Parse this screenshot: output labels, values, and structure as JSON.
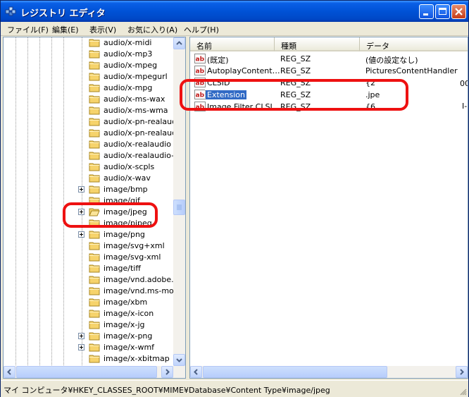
{
  "window": {
    "title": "レジストリ エディタ",
    "title_icon": "registry-editor-icon",
    "controls": [
      "minimize-icon",
      "maximize-icon",
      "close-icon"
    ]
  },
  "menu": [
    {
      "label": "ファイル(F)"
    },
    {
      "label": "編集(E)"
    },
    {
      "label": "表示(V)"
    },
    {
      "label": "お気に入り(A)"
    },
    {
      "label": "ヘルプ(H)"
    }
  ],
  "tree": {
    "items": [
      {
        "label": "audio/x-midi",
        "expander": false
      },
      {
        "label": "audio/x-mp3",
        "expander": false
      },
      {
        "label": "audio/x-mpeg",
        "expander": false
      },
      {
        "label": "audio/x-mpegurl",
        "expander": false
      },
      {
        "label": "audio/x-mpg",
        "expander": false
      },
      {
        "label": "audio/x-ms-wax",
        "expander": false
      },
      {
        "label": "audio/x-ms-wma",
        "expander": false
      },
      {
        "label": "audio/x-pn-realaudi",
        "expander": false
      },
      {
        "label": "audio/x-pn-realaudi",
        "expander": false
      },
      {
        "label": "audio/x-realaudio",
        "expander": false
      },
      {
        "label": "audio/x-realaudio-s",
        "expander": false
      },
      {
        "label": "audio/x-scpls",
        "expander": false
      },
      {
        "label": "audio/x-wav",
        "expander": false
      },
      {
        "label": "image/bmp",
        "expander": true
      },
      {
        "label": "image/gif",
        "expander": false
      },
      {
        "label": "image/jpeg",
        "expander": true,
        "open": true
      },
      {
        "label": "image/pjpeg",
        "expander": false
      },
      {
        "label": "image/png",
        "expander": true
      },
      {
        "label": "image/svg+xml",
        "expander": false
      },
      {
        "label": "image/svg-xml",
        "expander": false
      },
      {
        "label": "image/tiff",
        "expander": false
      },
      {
        "label": "image/vnd.adobe.sve",
        "expander": false
      },
      {
        "label": "image/vnd.ms-modi",
        "expander": false
      },
      {
        "label": "image/xbm",
        "expander": false
      },
      {
        "label": "image/x-icon",
        "expander": false
      },
      {
        "label": "image/x-jg",
        "expander": false
      },
      {
        "label": "image/x-png",
        "expander": true
      },
      {
        "label": "image/x-wmf",
        "expander": true
      },
      {
        "label": "image/x-xbitmap",
        "expander": false
      }
    ]
  },
  "list": {
    "columns": [
      "名前",
      "種類",
      "データ"
    ],
    "rows": [
      {
        "name": "(既定)",
        "type": "REG_SZ",
        "data": "(値の設定なし)"
      },
      {
        "name": "AutoplayContent…",
        "type": "REG_SZ",
        "data": "PicturesContentHandler"
      },
      {
        "name": "CLSID",
        "type": "REG_SZ",
        "data": "{2"
      },
      {
        "name": "Extension",
        "type": "REG_SZ",
        "data": ".jpe",
        "selected": true
      },
      {
        "name": "Image Filter CLSI…",
        "type": "REG_SZ",
        "data": "{6"
      }
    ],
    "overflow_marks": [
      "00",
      "I-"
    ]
  },
  "status": {
    "path": "マイ コンピュータ¥HKEY_CLASSES_ROOT¥MIME¥Database¥Content Type¥image/jpeg"
  },
  "colors": {
    "titlebar": "#0052d6",
    "selection": "#316ac5",
    "callout": "#ee1111",
    "folder": "#f6d36b"
  },
  "icons": {
    "folder": "folder-icon",
    "open_folder": "open-folder-icon",
    "string_value": "string-value-icon",
    "expand": "plus-box-icon"
  }
}
